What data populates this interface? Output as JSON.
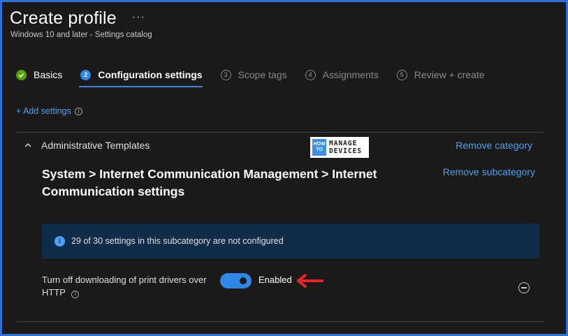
{
  "header": {
    "title": "Create profile",
    "more": "···",
    "subtitle": "Windows 10 and later - Settings catalog"
  },
  "steps": [
    {
      "number": "",
      "label": "Basics",
      "state": "done"
    },
    {
      "number": "2",
      "label": "Configuration settings",
      "state": "active"
    },
    {
      "number": "3",
      "label": "Scope tags",
      "state": "todo"
    },
    {
      "number": "4",
      "label": "Assignments",
      "state": "todo"
    },
    {
      "number": "5",
      "label": "Review + create",
      "state": "todo"
    }
  ],
  "add_settings": {
    "label": "+ Add settings",
    "info": "i"
  },
  "category": {
    "name": "Administrative Templates",
    "remove_category": "Remove category",
    "remove_subcategory": "Remove subcategory",
    "path_title": "System > Internet Communication Management > Internet Communication settings"
  },
  "logo": {
    "how": "HOW",
    "to": "TO",
    "line1": "MANAGE",
    "line2": "DEVICES"
  },
  "banner": {
    "icon": "i",
    "text": "29 of 30 settings in this subcategory are not configured"
  },
  "setting": {
    "label": "Turn off downloading of print drivers over HTTP",
    "info": "i",
    "toggle_state": "Enabled",
    "enabled": true
  },
  "colors": {
    "accent": "#2f88e8",
    "link": "#4ea0f2",
    "success": "#57a300",
    "frame": "#2f6fd6",
    "arrow": "#e8242a"
  }
}
